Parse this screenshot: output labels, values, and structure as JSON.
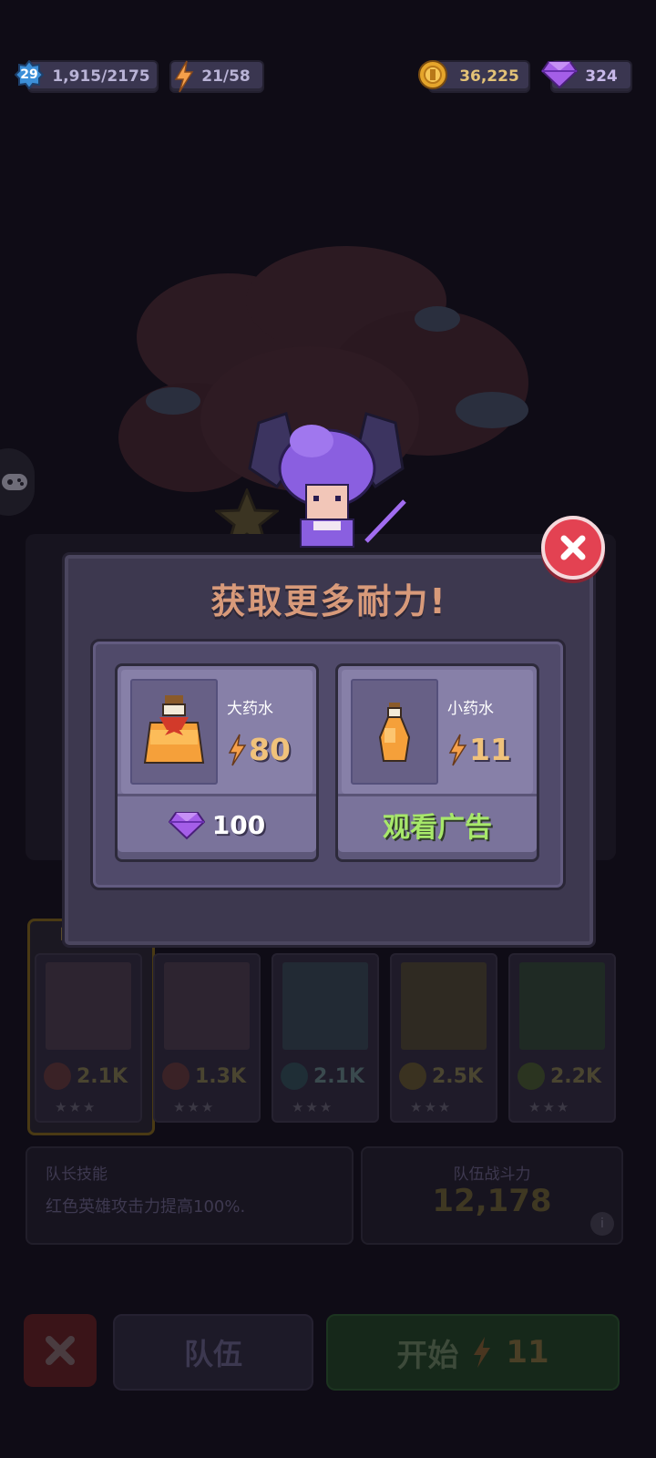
{
  "top_bar": {
    "level": "29",
    "xp": "1,915/2175",
    "energy": "21/58",
    "coins": "36,225",
    "gems": "324",
    "colors": {
      "energy": "#f5a04a",
      "coin": "#e5a52b",
      "gem": "#a45ee8"
    }
  },
  "modal": {
    "title": "获取更多耐力!",
    "cards": [
      {
        "name": "大药水",
        "amount": "80",
        "icon": "large-potion-icon",
        "cost": "100",
        "cost_icon": "gem-icon"
      },
      {
        "name": "小药水",
        "amount": "11",
        "icon": "small-potion-icon",
        "action": "观看广告"
      }
    ]
  },
  "team": {
    "captain_tag": "队长",
    "heroes": [
      {
        "power": "2.1K",
        "stars": "★★★"
      },
      {
        "power": "1.3K",
        "stars": "★★★"
      },
      {
        "power": "2.1K",
        "stars": "★★★"
      },
      {
        "power": "2.5K",
        "stars": "★★★"
      },
      {
        "power": "2.2K",
        "stars": "★★★"
      }
    ],
    "skill_label": "队长技能",
    "skill_desc": "红色英雄攻击力提高100%.",
    "power_label": "队伍战斗力",
    "power_value": "12,178"
  },
  "bottom": {
    "team_button": "队伍",
    "start_button": "开始",
    "start_cost": "11"
  }
}
